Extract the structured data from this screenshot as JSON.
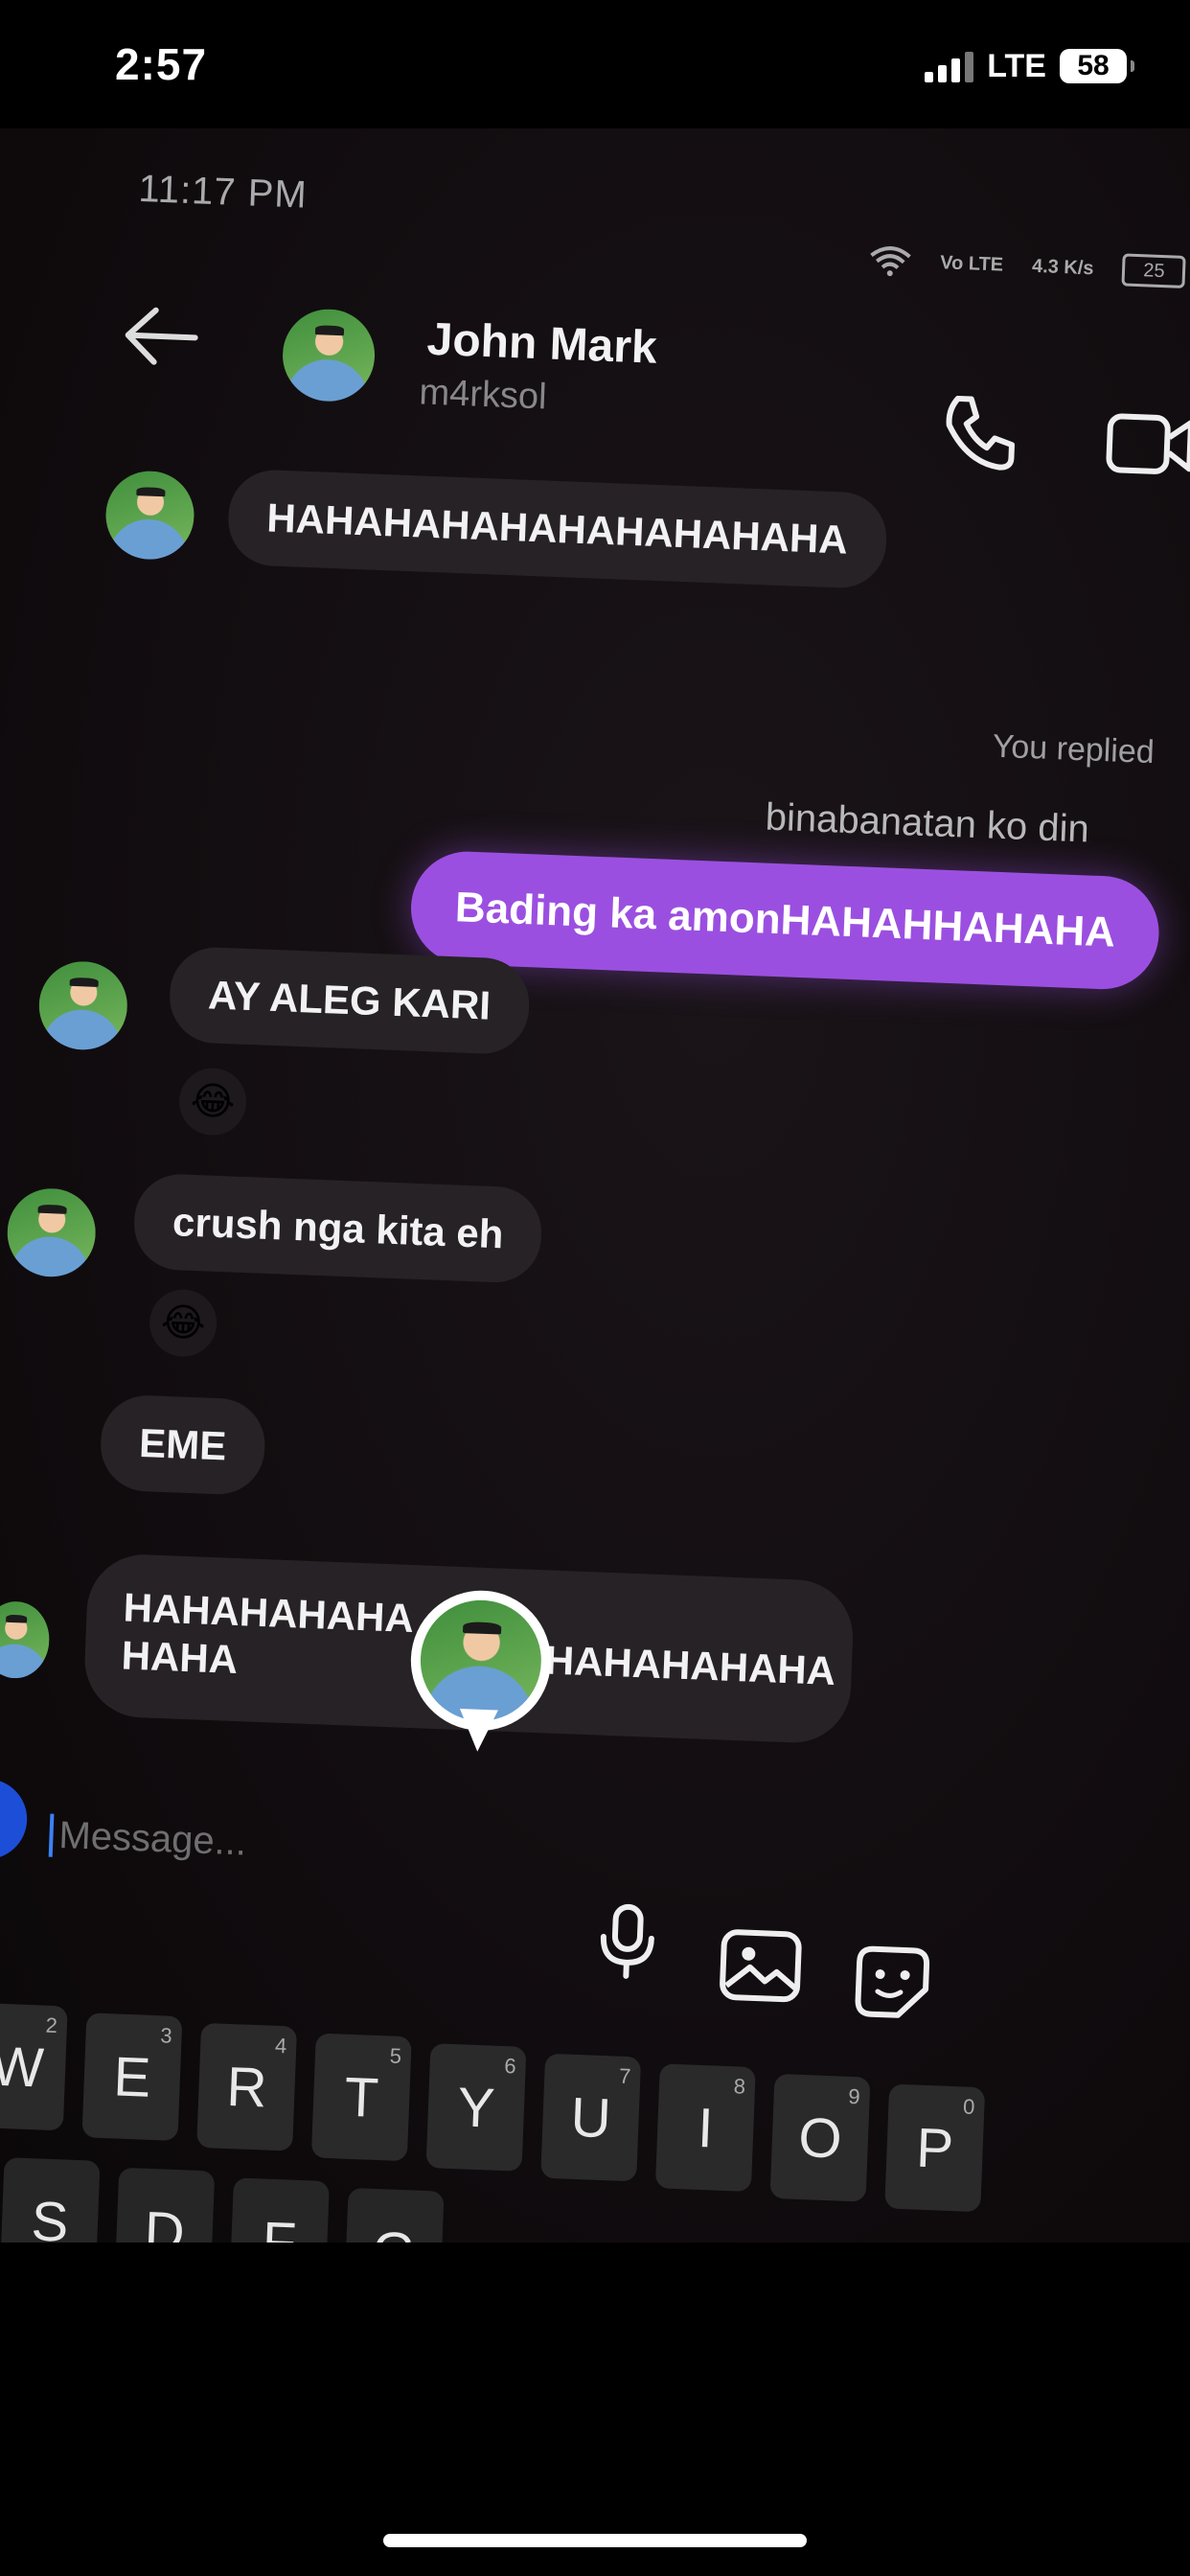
{
  "outer_status": {
    "time": "2:57",
    "network": "LTE",
    "battery": "58"
  },
  "inner_status": {
    "time": "11:17 PM",
    "volte": "Vo LTE",
    "speed": "4.3 K/s",
    "battery": "25"
  },
  "header": {
    "contact_name": "John Mark",
    "handle": "m4rksol"
  },
  "messages": {
    "m1": "HAHAHAHAHAHAHAHAHAHA",
    "you_replied": "You replied",
    "quoted": "binabanatan ko din",
    "sent": "Bading ka amonHAHAHHAHAHA",
    "m2": "AY ALEG KARI",
    "m3": "crush nga kita eh",
    "m4": "EME",
    "m5_l1": "HAHAHAHAHA",
    "m5_l2": "HAHA",
    "m5_l3": "HAHAHAHAHA",
    "reaction": "😂"
  },
  "composer": {
    "placeholder": "Message..."
  },
  "keyboard": {
    "row1": [
      {
        "key": "W",
        "hint": "2"
      },
      {
        "key": "E",
        "hint": "3"
      },
      {
        "key": "R",
        "hint": "4"
      },
      {
        "key": "T",
        "hint": "5"
      },
      {
        "key": "Y",
        "hint": "6"
      },
      {
        "key": "U",
        "hint": "7"
      },
      {
        "key": "I",
        "hint": "8"
      },
      {
        "key": "O",
        "hint": "9"
      },
      {
        "key": "P",
        "hint": "0"
      }
    ],
    "row2": [
      "S",
      "D",
      "F",
      "G"
    ]
  }
}
